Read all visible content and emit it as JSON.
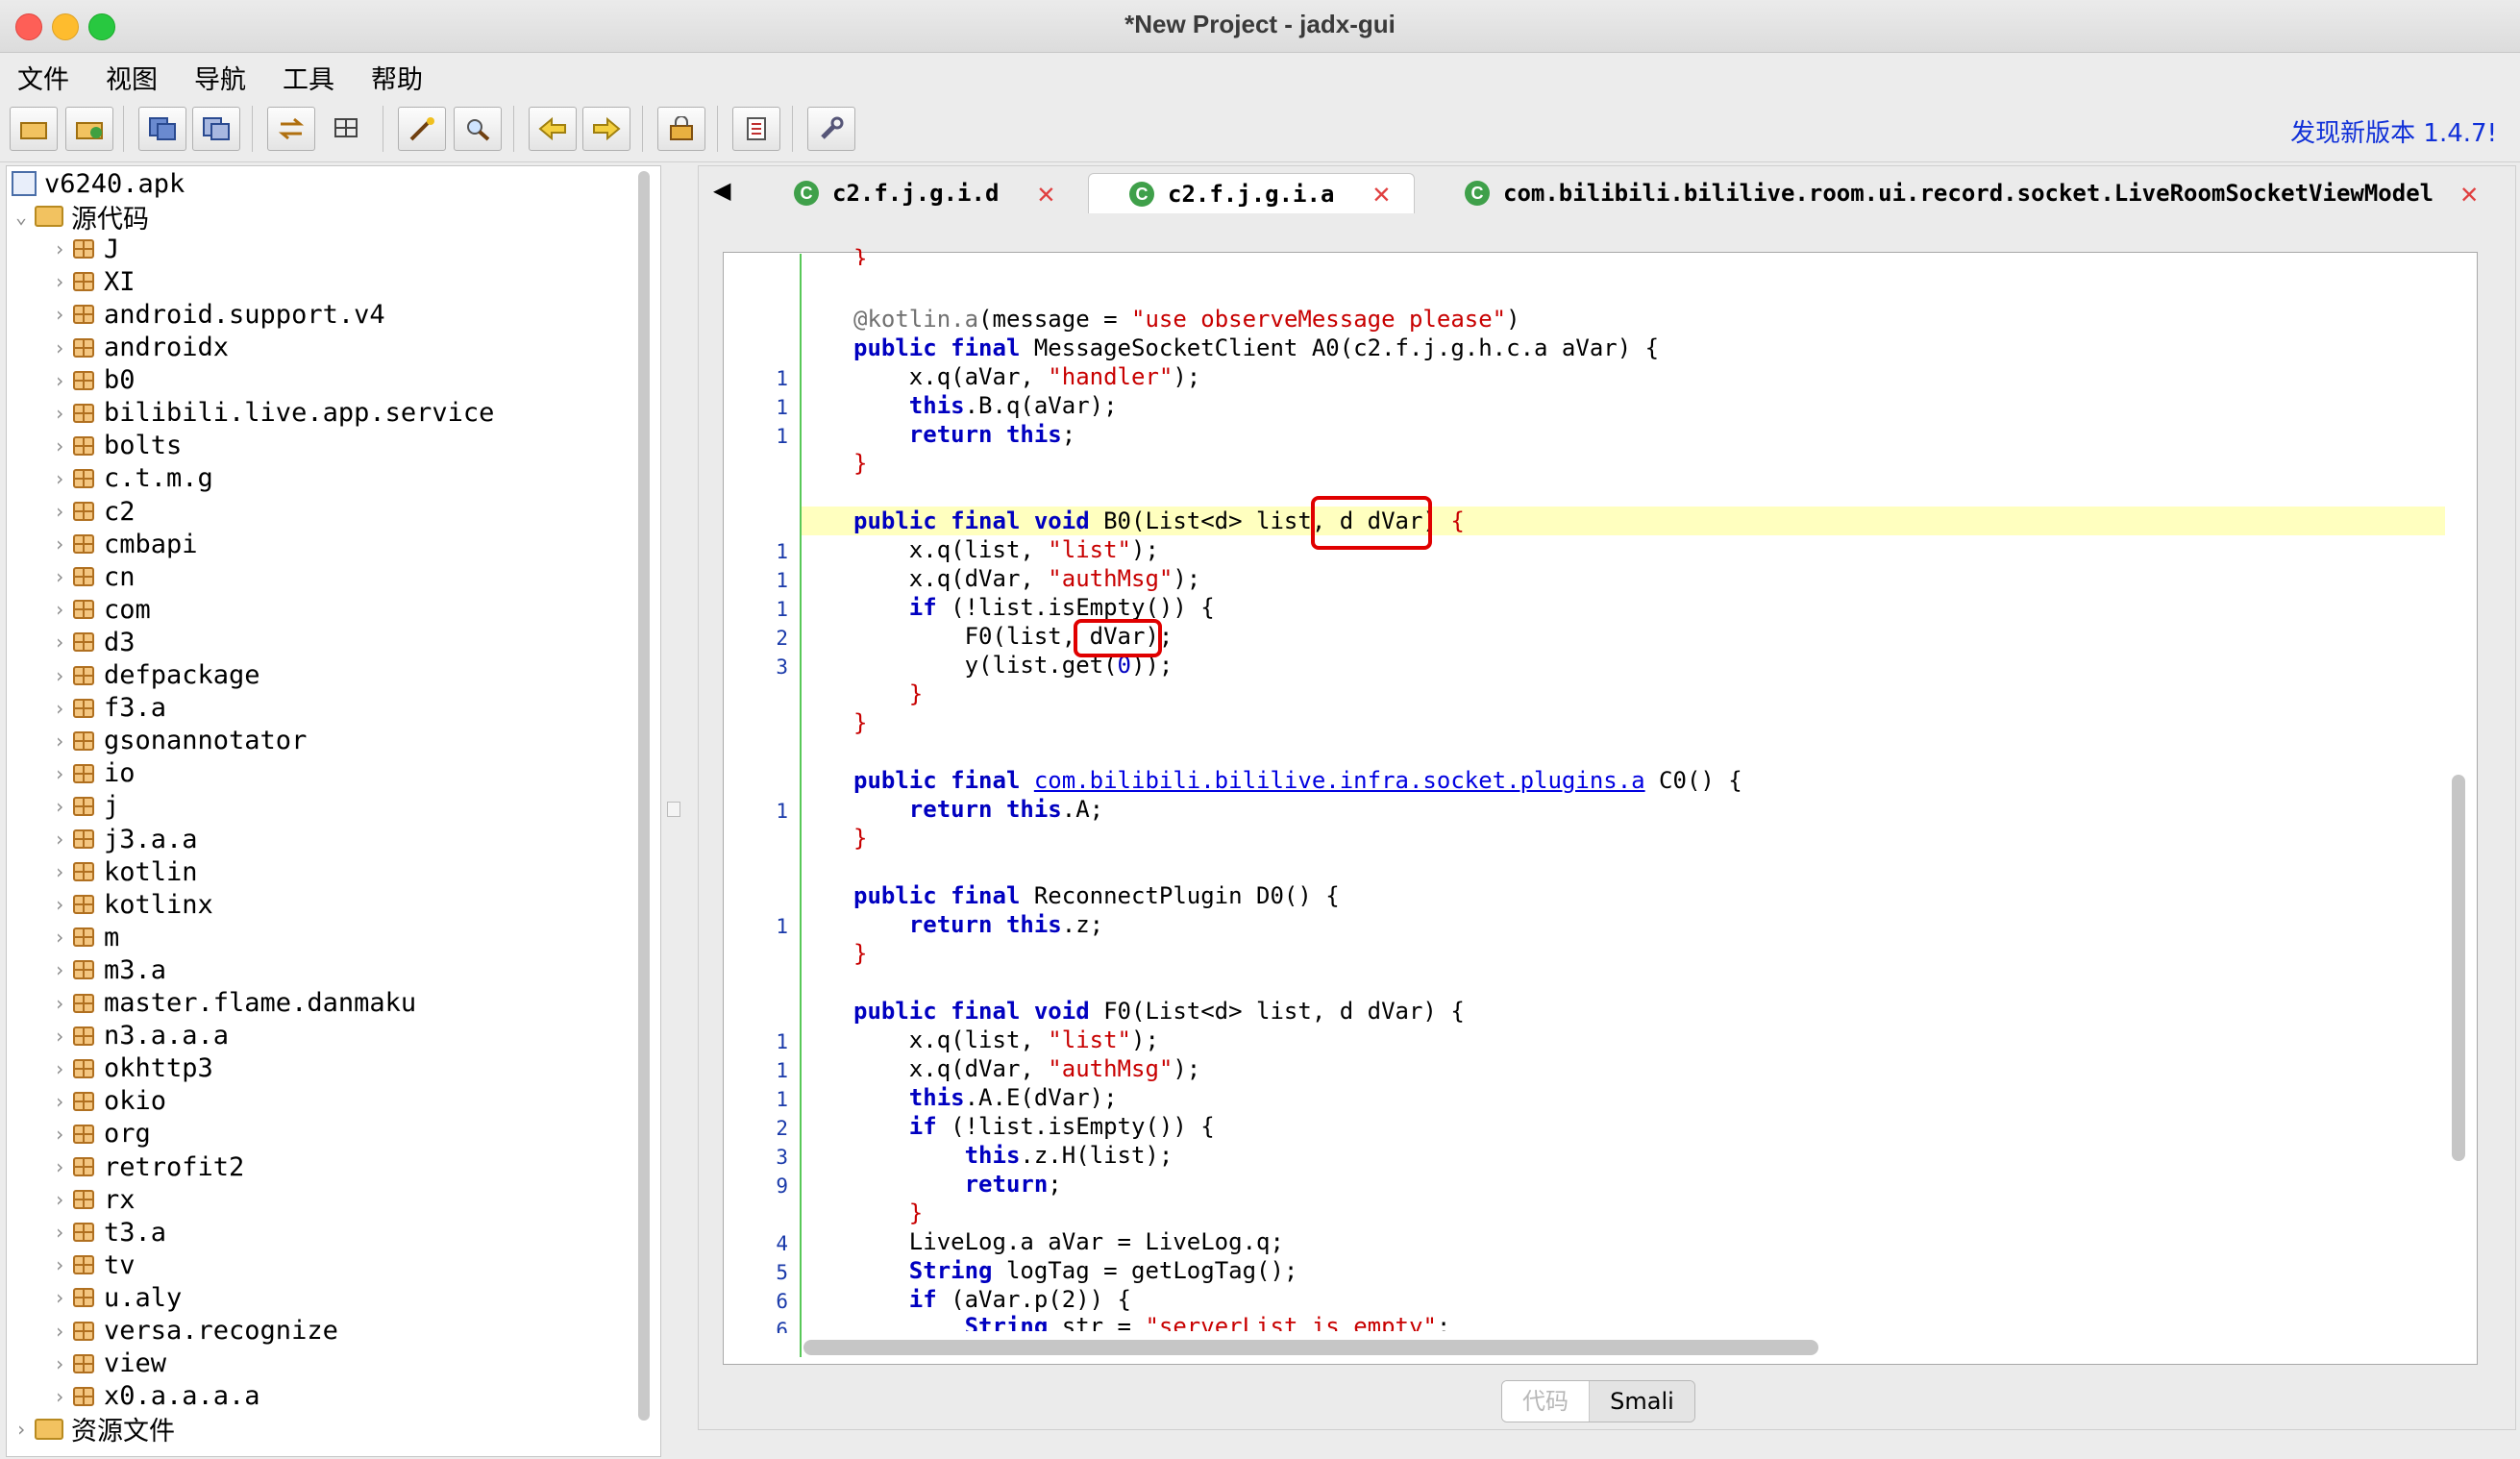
{
  "window": {
    "title": "*New Project - jadx-gui"
  },
  "menu": [
    "文件",
    "视图",
    "导航",
    "工具",
    "帮助"
  ],
  "toolbar": {
    "update_link": "发现新版本 1.4.7!"
  },
  "tree": {
    "root": "v6240.apk",
    "source_folder": "源代码",
    "packages": [
      "J",
      "XI",
      "android.support.v4",
      "androidx",
      "b0",
      "bilibili.live.app.service",
      "bolts",
      "c.t.m.g",
      "c2",
      "cmbapi",
      "cn",
      "com",
      "d3",
      "defpackage",
      "f3.a",
      "gsonannotator",
      "io",
      "j",
      "j3.a.a",
      "kotlin",
      "kotlinx",
      "m",
      "m3.a",
      "master.flame.danmaku",
      "n3.a.a.a",
      "okhttp3",
      "okio",
      "org",
      "retrofit2",
      "rx",
      "t3.a",
      "tv",
      "u.aly",
      "versa.recognize",
      "view",
      "x0.a.a.a.a"
    ],
    "resources_folder": "资源文件"
  },
  "tabs": [
    {
      "label": "c2.f.j.g.i.d",
      "icon": "C",
      "active": false
    },
    {
      "label": "c2.f.j.g.i.a",
      "icon": "C",
      "active": true
    },
    {
      "label": "com.bilibili.bililive.room.ui.record.socket.LiveRoomSocketViewModel",
      "icon": "C",
      "active": false
    }
  ],
  "code": {
    "line_numbers": [
      "1",
      "1",
      "1",
      "1",
      "1",
      "1",
      "2",
      "3",
      "1",
      "1",
      "1",
      "1",
      "1",
      "2",
      "3",
      "9",
      "4",
      "5",
      "6",
      "6"
    ],
    "lines": {
      "l0": "}",
      "l1_ann": "@kotlin.a",
      "l1_a": "(message = ",
      "l1_str": "\"use observeMessage please\"",
      "l1_b": ")",
      "l2_kw": "public final",
      "l2_a": " MessageSocketClient A0",
      "l2_b": "(c2.f.j.g.h.c.a aVar) {",
      "l3_a": "    x.q(aVar, ",
      "l3_str": "\"handler\"",
      "l3_b": ");",
      "l4_kw": "    this",
      "l4_a": ".B.q(aVar);",
      "l5_kw": "    return this",
      "l5_a": ";",
      "l6": "}",
      "l7_kw": "public final void",
      "l7_a": " B0(List<d> list, ",
      "l7_box": "d dVar)",
      "l7_b": " {",
      "l8_a": "    x.q(list, ",
      "l8_str": "\"list\"",
      "l8_b": ");",
      "l9_a": "    x.q(dVar, ",
      "l9_str": "\"authMsg\"",
      "l9_b": ");",
      "l10_kw": "    if",
      "l10_a": " (!list.isEmpty()) {",
      "l11_a": "        F0(list, ",
      "l11_box": "dVar",
      "l11_b": ");",
      "l12_a": "        y(list.get(",
      "l12_num": "0",
      "l12_b": "));",
      "l13": "    }",
      "l14": "}",
      "l15_kw": "public final",
      "l15_link": "com.bilibili.bililive.infra.socket.plugins.a",
      "l15_a": " C0() {",
      "l16_kw": "    return this",
      "l16_a": ".A;",
      "l17": "}",
      "l18_kw": "public final",
      "l18_a": " ReconnectPlugin D0() {",
      "l19_kw": "    return this",
      "l19_a": ".z;",
      "l20": "}",
      "l21_kw": "public final void",
      "l21_a": " F0(List<d> list, d dVar) {",
      "l22_a": "    x.q(list, ",
      "l22_str": "\"list\"",
      "l22_b": ");",
      "l23_a": "    x.q(dVar, ",
      "l23_str": "\"authMsg\"",
      "l23_b": ");",
      "l24_kw": "    this",
      "l24_a": ".A.E(dVar);",
      "l25_kw": "    if",
      "l25_a": " (!list.isEmpty()) {",
      "l26_kw": "        this",
      "l26_a": ".z.H(list);",
      "l27_kw": "        return",
      "l27_a": ";",
      "l28": "    }",
      "l29_a": "    LiveLog.a aVar = LiveLog.q;",
      "l30_kw": "    String",
      "l30_a": " logTag = getLogTag();",
      "l31_kw": "    if",
      "l31_a": " (aVar.p(2)) {",
      "l32_kw": "        String",
      "l32_a": " str = ",
      "l32_str": "\"serverList is empty\"",
      "l32_b": ";"
    }
  },
  "bottom_toggle": {
    "code": "代码",
    "smali": "Smali"
  },
  "colors": {
    "keyword": "#0000c0",
    "string": "#c80000",
    "highlight": "#ffffbf",
    "annotation_box": "#e00000",
    "link": "#1030d8"
  }
}
